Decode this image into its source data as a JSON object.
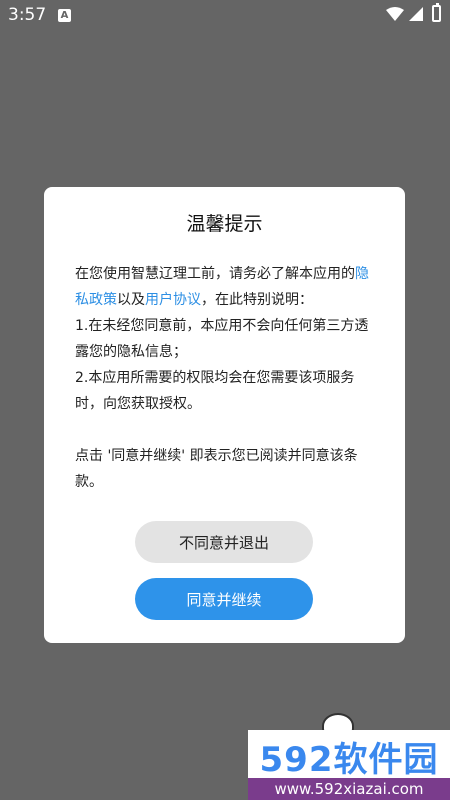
{
  "status_bar": {
    "time": "3:57",
    "notification_icon": "A",
    "icons": [
      "wifi-icon",
      "signal-icon",
      "battery-icon"
    ]
  },
  "dialog": {
    "title": "温馨提示",
    "intro_prefix": "在您使用智慧辽理工前，请务必了解本应用的",
    "privacy_link": "隐私政策",
    "and_text": "以及",
    "agreement_link": "用户协议",
    "intro_suffix": "，在此特别说明：",
    "item1": "1.在未经您同意前，本应用不会向任何第三方透露您的隐私信息；",
    "item2": "2.本应用所需要的权限均会在您需要该项服务时，向您获取授权。",
    "footer": "点击 '同意并继续' 即表示您已阅读并同意该条款。",
    "disagree_label": "不同意并退出",
    "agree_label": "同意并继续"
  },
  "watermark": {
    "brand": "592软件园",
    "url": "www.592xiazai.com"
  },
  "colors": {
    "backdrop": "#656565",
    "link": "#2d8fe4",
    "agree_button": "#2e93ea",
    "disagree_button": "#e3e3e3"
  }
}
